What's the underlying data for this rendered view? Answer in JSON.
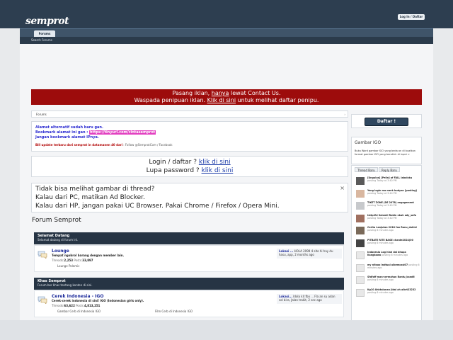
{
  "header": {
    "logo": "semprot",
    "login_label": "Log In / Daftar",
    "nav_tab": "Forums",
    "subnav": "Search Forums"
  },
  "ad_banner": {
    "line1_pre": "Pasang iklan, ",
    "line1_link": "hanya",
    "line1_post": " lewat Contact Us.",
    "line2_pre": "Waspada penipuan iklan. ",
    "line2_link": "Klik di sini",
    "line2_post": " untuk melihat daftar penipu."
  },
  "breadcrumb": {
    "label": "Forums"
  },
  "notice": {
    "line1": "Alamat alternatif sudah baru gan.",
    "line2_pre": "Bookmark alamat ini gan : ",
    "line2_url": "https://tinyurl.com/cintasemprot",
    "line3": "Jangan bookmark alamat IPnya.",
    "line4_red": "Bill update terbaru dari semprot in datamanen 40 dari",
    "line4_rest": " : Follow @SemprotCom / Facebook"
  },
  "login_box": {
    "line1_pre": "Login / daftar ? ",
    "line1_link": "klik di sini",
    "line2_pre": "Lupa password ? ",
    "line2_link": "klik di sini"
  },
  "warning": {
    "line1": "Tidak bisa melihat gambar di thread?",
    "line2": "Kalau dari PC, matikan Ad Blocker.",
    "line3": "Kalau dari HP, jangan pakai UC Browser. Pakai Chrome / Firefox / Opera Mini."
  },
  "forum_heading": "Forum Semprot",
  "categories": [
    {
      "title": "Selamat Datang",
      "subtitle": "Selamat datang di forum ini.",
      "forum": {
        "title": "Lounge",
        "desc": "Tempat ngobrol barang dengan member lain.",
        "threads_label": "Threads:",
        "threads": "2,253",
        "posts_label": " Posts:",
        "posts": "33,897",
        "sub1": "Lounge Polemic",
        "sub2": "",
        "last_title": "Lokasi ...",
        "last_meta": "HOLA 2099 4 site hi hay du hasu, app, 2 months ago"
      }
    },
    {
      "title": "Khas Semprot",
      "subtitle": "Forum ber khas tentang konten di sini.",
      "forum": {
        "title": "Cerek Indonesia - IGO",
        "desc": "Cerek-cerek indonesia di sini! IGO (Indonesian girls only).",
        "threads_label": "Threads:",
        "threads": "63,622",
        "posts_label": " Posts:",
        "posts": "4,813,251",
        "sub1": "Gambar Cerb di Indonesia IGO",
        "sub2": "Film Cerb di Indonesia IGO",
        "last_title": "Lokasi...",
        "last_meta": "Idola kit fbo ... Fla an su adan sol bira, Jalan trakit, 2 sec ago"
      }
    }
  ],
  "sidebar": {
    "daftar_label": "Daftar !",
    "gambar_title": "Gambar IGO",
    "gambar_body": "Buka Word gambar IGO yang beda an di buatkan format gambar IGO yang berakhir di input >",
    "tabs": [
      "Thread Baru",
      "Reply Baru"
    ],
    "threads": [
      {
        "title": "[Ungulus] [Pelin] of FALL labolyku",
        "meta": "posting Today at 3:40 PM"
      },
      {
        "title": "Yang login ma merk budyan [posting]",
        "meta": "posting Today at 3:40 PM"
      },
      {
        "title": "TIKET ZONE (DE 2078) engagement",
        "meta": "posting Today at 3:40 PM"
      },
      {
        "title": "Isttp:Ed Solomil Robin nkah ady_sofa",
        "meta": "posting Today at 3:40 PM"
      },
      {
        "title": "Cerita Lanjutan 2018 fan Ranu_dahlei",
        "meta": "posting 6 minutes ago"
      },
      {
        "title": "PITBATE RITE BAGE chante2024(00",
        "meta": "posting 6 minutes ago"
      },
      {
        "title": "Indonesia Log hlah dai bhapa Kangkowa",
        "meta": "posting 6 minutes ago"
      },
      {
        "title": "my nItsoo Indtual albemcasi07",
        "meta": "posting 6 minutes ago"
      },
      {
        "title": "Sfdfoff man-cermahan Rantu_kand6",
        "meta": "posting 6 minutes ago"
      },
      {
        "title": "Kg10 Ahktalunan Jidal ah albrt23232",
        "meta": "posting 6 minutes ago"
      }
    ]
  }
}
